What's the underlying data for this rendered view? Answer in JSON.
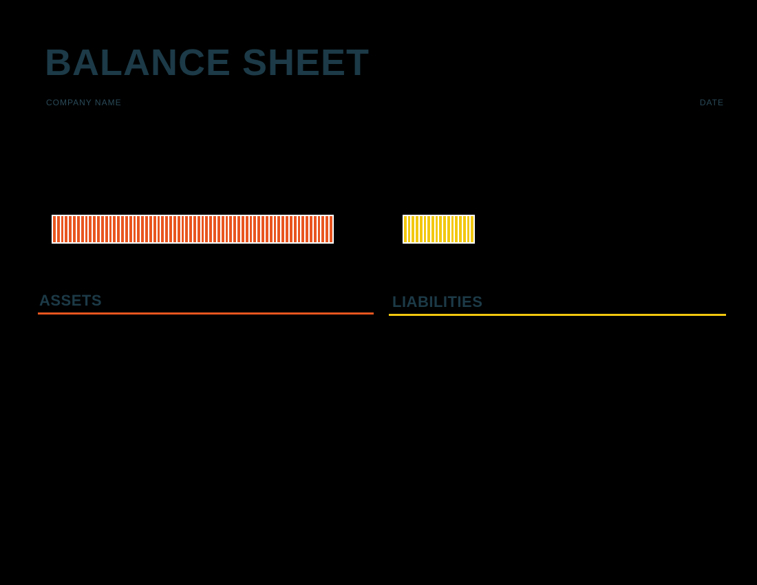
{
  "header": {
    "title": "BALANCE SHEET",
    "company_label": "COMPANY NAME",
    "date_label": "DATE"
  },
  "sections": {
    "assets": {
      "label": "ASSETS",
      "color": "#e8551f"
    },
    "liabilities": {
      "label": "LIABILITIES",
      "color": "#f2c80f"
    }
  },
  "chart_data": {
    "type": "bar",
    "orientation": "horizontal",
    "series": [
      {
        "name": "Assets",
        "value": 410,
        "color": "#e8551f"
      },
      {
        "name": "Liabilities",
        "value": 105,
        "color": "#f2c80f"
      }
    ],
    "note": "bar lengths read from pixel width; no numeric axis labels visible"
  }
}
